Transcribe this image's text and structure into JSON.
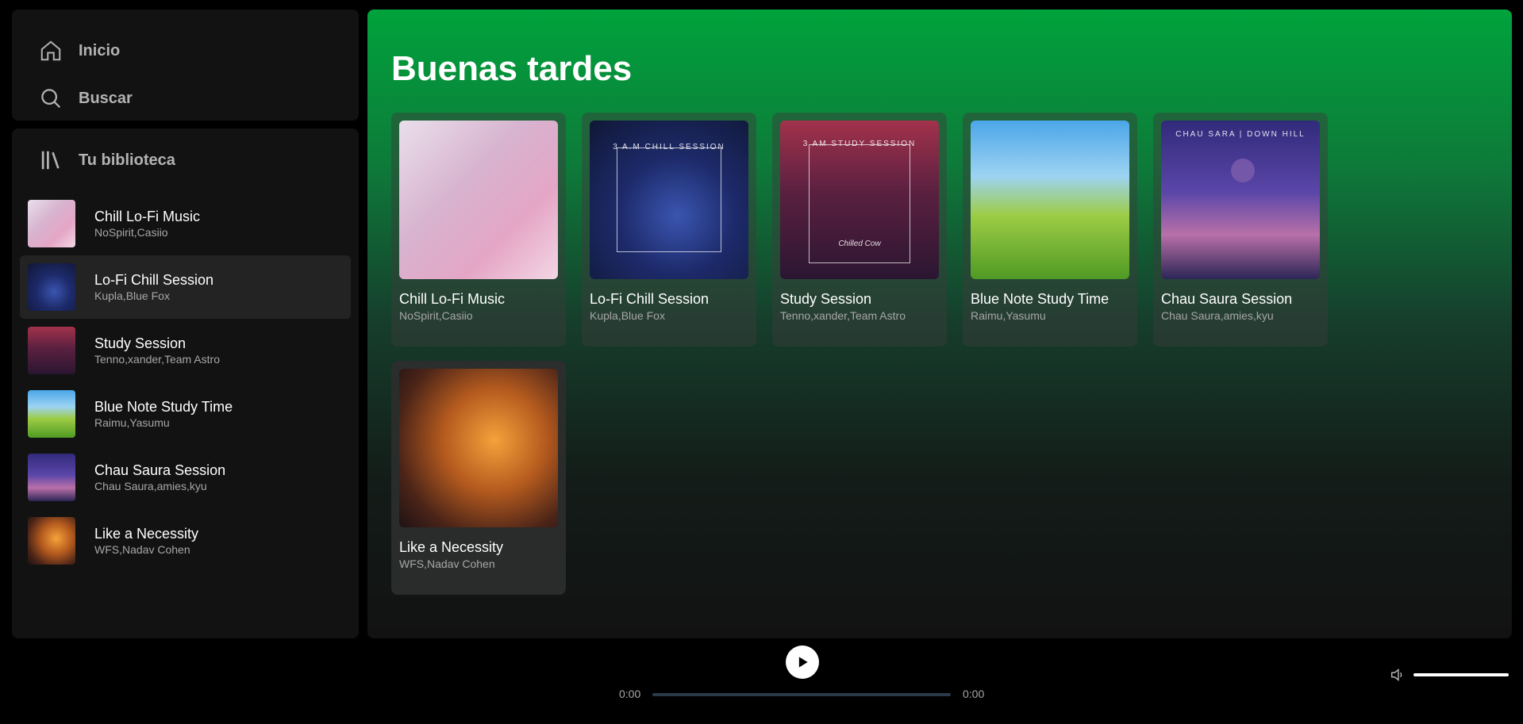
{
  "nav": {
    "home_label": "Inicio",
    "search_label": "Buscar"
  },
  "library": {
    "title": "Tu biblioteca",
    "items": [
      {
        "title": "Chill Lo-Fi Music",
        "artists": "NoSpirit,Casiio"
      },
      {
        "title": "Lo-Fi Chill Session",
        "artists": "Kupla,Blue Fox"
      },
      {
        "title": "Study Session",
        "artists": "Tenno,xander,Team Astro"
      },
      {
        "title": "Blue Note Study Time",
        "artists": "Raimu,Yasumu"
      },
      {
        "title": "Chau Saura Session",
        "artists": "Chau Saura,amies,kyu"
      },
      {
        "title": "Like a Necessity",
        "artists": "WFS,Nadav Cohen"
      }
    ]
  },
  "main": {
    "greeting": "Buenas tardes",
    "cards": [
      {
        "title": "Chill Lo-Fi Music",
        "artists": "NoSpirit,Casiio"
      },
      {
        "title": "Lo-Fi Chill Session",
        "artists": "Kupla,Blue Fox",
        "art_text": "3 A.M CHILL SESSION"
      },
      {
        "title": "Study Session",
        "artists": "Tenno,xander,Team Astro",
        "art_text": "3 AM STUDY SESSION",
        "art_sub": "Chilled Cow"
      },
      {
        "title": "Blue Note Study Time",
        "artists": "Raimu,Yasumu"
      },
      {
        "title": "Chau Saura Session",
        "artists": "Chau Saura,amies,kyu",
        "art_text": "CHAU SARA | DOWN HILL"
      },
      {
        "title": "Like a Necessity",
        "artists": "WFS,Nadav Cohen"
      }
    ]
  },
  "player": {
    "current_time": "0:00",
    "total_time": "0:00",
    "progress": 0,
    "volume": 1.0
  },
  "colors": {
    "accent_green": "#00a33c",
    "panel_bg": "#121212",
    "muted_text": "#a7a7a7"
  }
}
